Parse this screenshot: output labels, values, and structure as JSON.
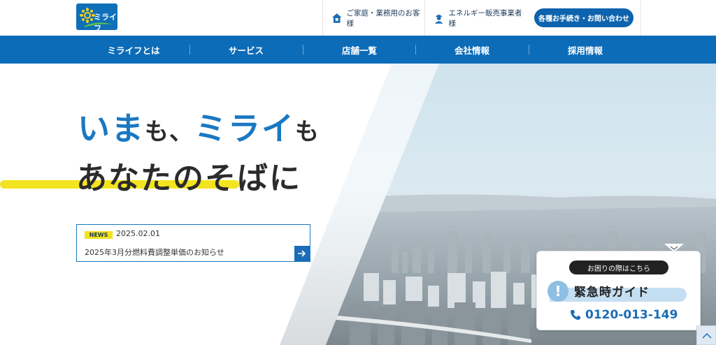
{
  "header": {
    "logo_text": "ミライフ",
    "home_link": "ご家庭・業務用のお客様",
    "energy_link": "エネルギー販売事業者様",
    "contact_button": "各種お手続き・お問い合わせ"
  },
  "nav": {
    "items": [
      {
        "label": "ミライフとは"
      },
      {
        "label": "サービス"
      },
      {
        "label": "店舗一覧"
      },
      {
        "label": "会社情報"
      },
      {
        "label": "採用情報"
      }
    ]
  },
  "hero": {
    "catch_part1": "いま",
    "catch_part2": "も、",
    "catch_part3": "ミライ",
    "catch_part4": "も",
    "catch_line2": "あなたのそばに"
  },
  "news": {
    "badge": "NEWS",
    "date": "2025.02.01",
    "title": "2025年3月分燃料費調整単価のお知らせ"
  },
  "emergency": {
    "badge": "お困りの際はこちら",
    "title": "緊急時ガイド",
    "phone": "0120-013-149"
  },
  "colors": {
    "brand_blue": "#0d6cb8",
    "catch_blue": "#1a78c2",
    "highlight_yellow": "#f3e41f"
  }
}
